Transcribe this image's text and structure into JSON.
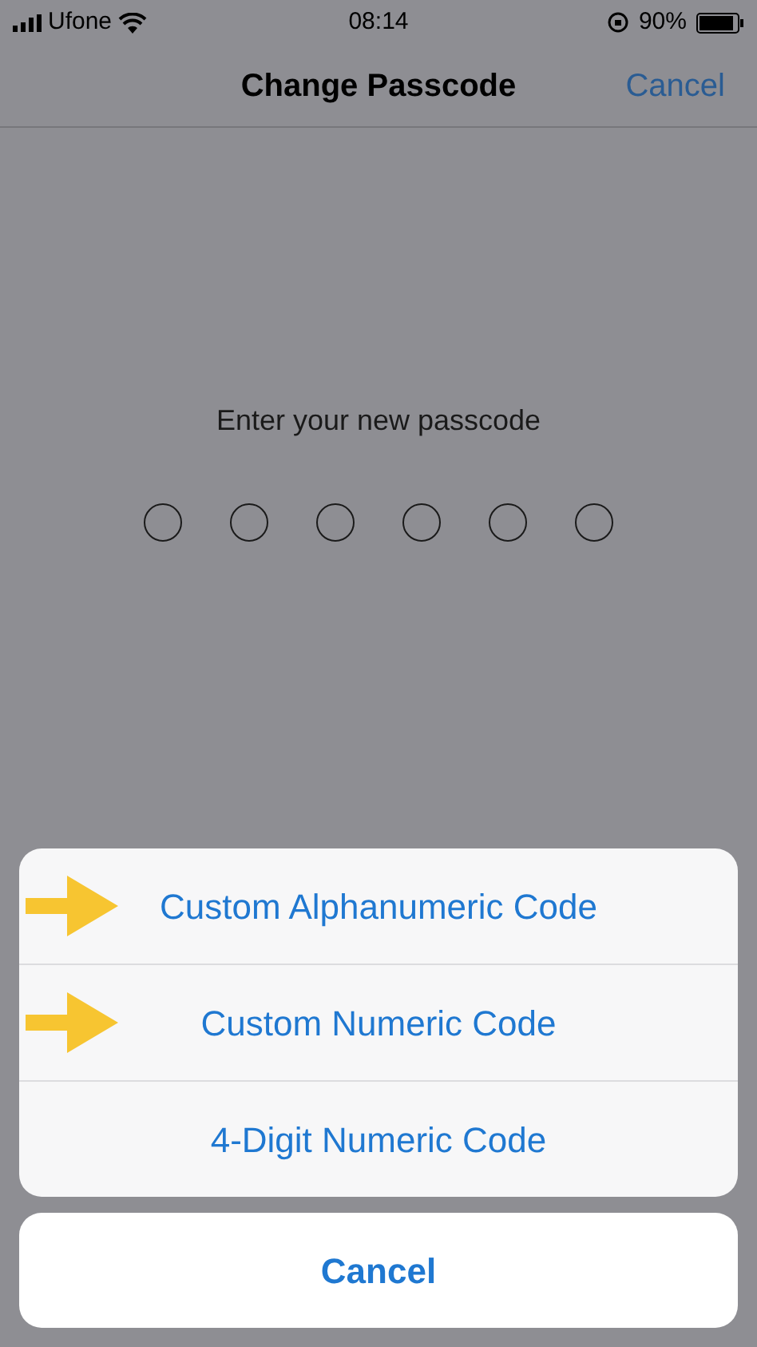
{
  "status_bar": {
    "carrier": "Ufone",
    "time": "08:14",
    "battery": "90%"
  },
  "nav": {
    "title": "Change Passcode",
    "action": "Cancel"
  },
  "prompt": "Enter your new passcode",
  "digits": [
    {
      "filled": false
    },
    {
      "filled": false
    },
    {
      "filled": false
    },
    {
      "filled": false
    },
    {
      "filled": false
    },
    {
      "filled": false
    }
  ],
  "sheet": {
    "options": [
      {
        "label": "Custom Alphanumeric Code",
        "marked": true
      },
      {
        "label": "Custom Numeric Code",
        "marked": true
      },
      {
        "label": "4-Digit Numeric Code",
        "marked": false
      }
    ],
    "cancel": "Cancel"
  }
}
